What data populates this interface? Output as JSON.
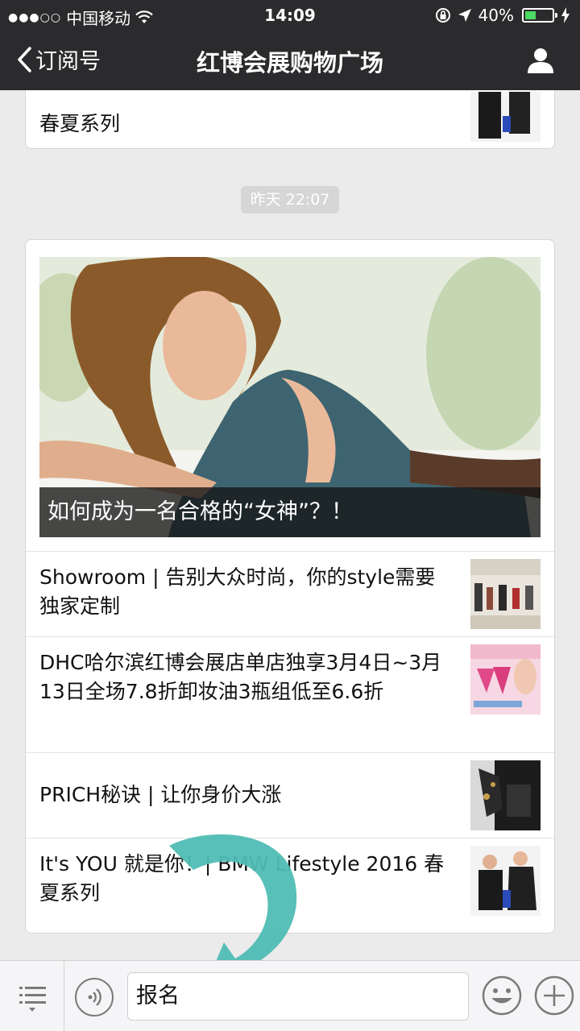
{
  "status_bar": {
    "carrier": "中国移动",
    "time": "14:09",
    "battery": "40%",
    "battery_level": 0.4
  },
  "nav": {
    "back_label": "订阅号",
    "title": "红博会展购物广场"
  },
  "previous_card": {
    "partial_title": "春夏系列"
  },
  "timestamp": "昨天 22:07",
  "main_card": {
    "hero_caption": "如何成为一名合格的“女神”？！",
    "articles": [
      {
        "title": "Showroom | 告别大众时尚，你的style需要独家定制"
      },
      {
        "title": "DHC哈尔滨红博会展店单店独享3月4日~3月13日全场7.8折卸妆油3瓶组低至6.6折"
      },
      {
        "title": "PRICH秘诀 | 让你身价大涨"
      },
      {
        "title": "It's YOU 就是你！| BMW Lifestyle 2016 春夏系列"
      }
    ]
  },
  "input": {
    "value": "报名"
  },
  "colors": {
    "nav_bg": "#2b2b2d",
    "arrow": "#4fbdb4",
    "battery_fill": "#4cd964"
  },
  "icons": [
    "wifi-icon",
    "lock-rotation-icon",
    "location-icon",
    "battery-icon",
    "back-chevron-icon",
    "profile-icon",
    "menu-list-icon",
    "voice-icon",
    "emoji-icon",
    "plus-icon"
  ]
}
